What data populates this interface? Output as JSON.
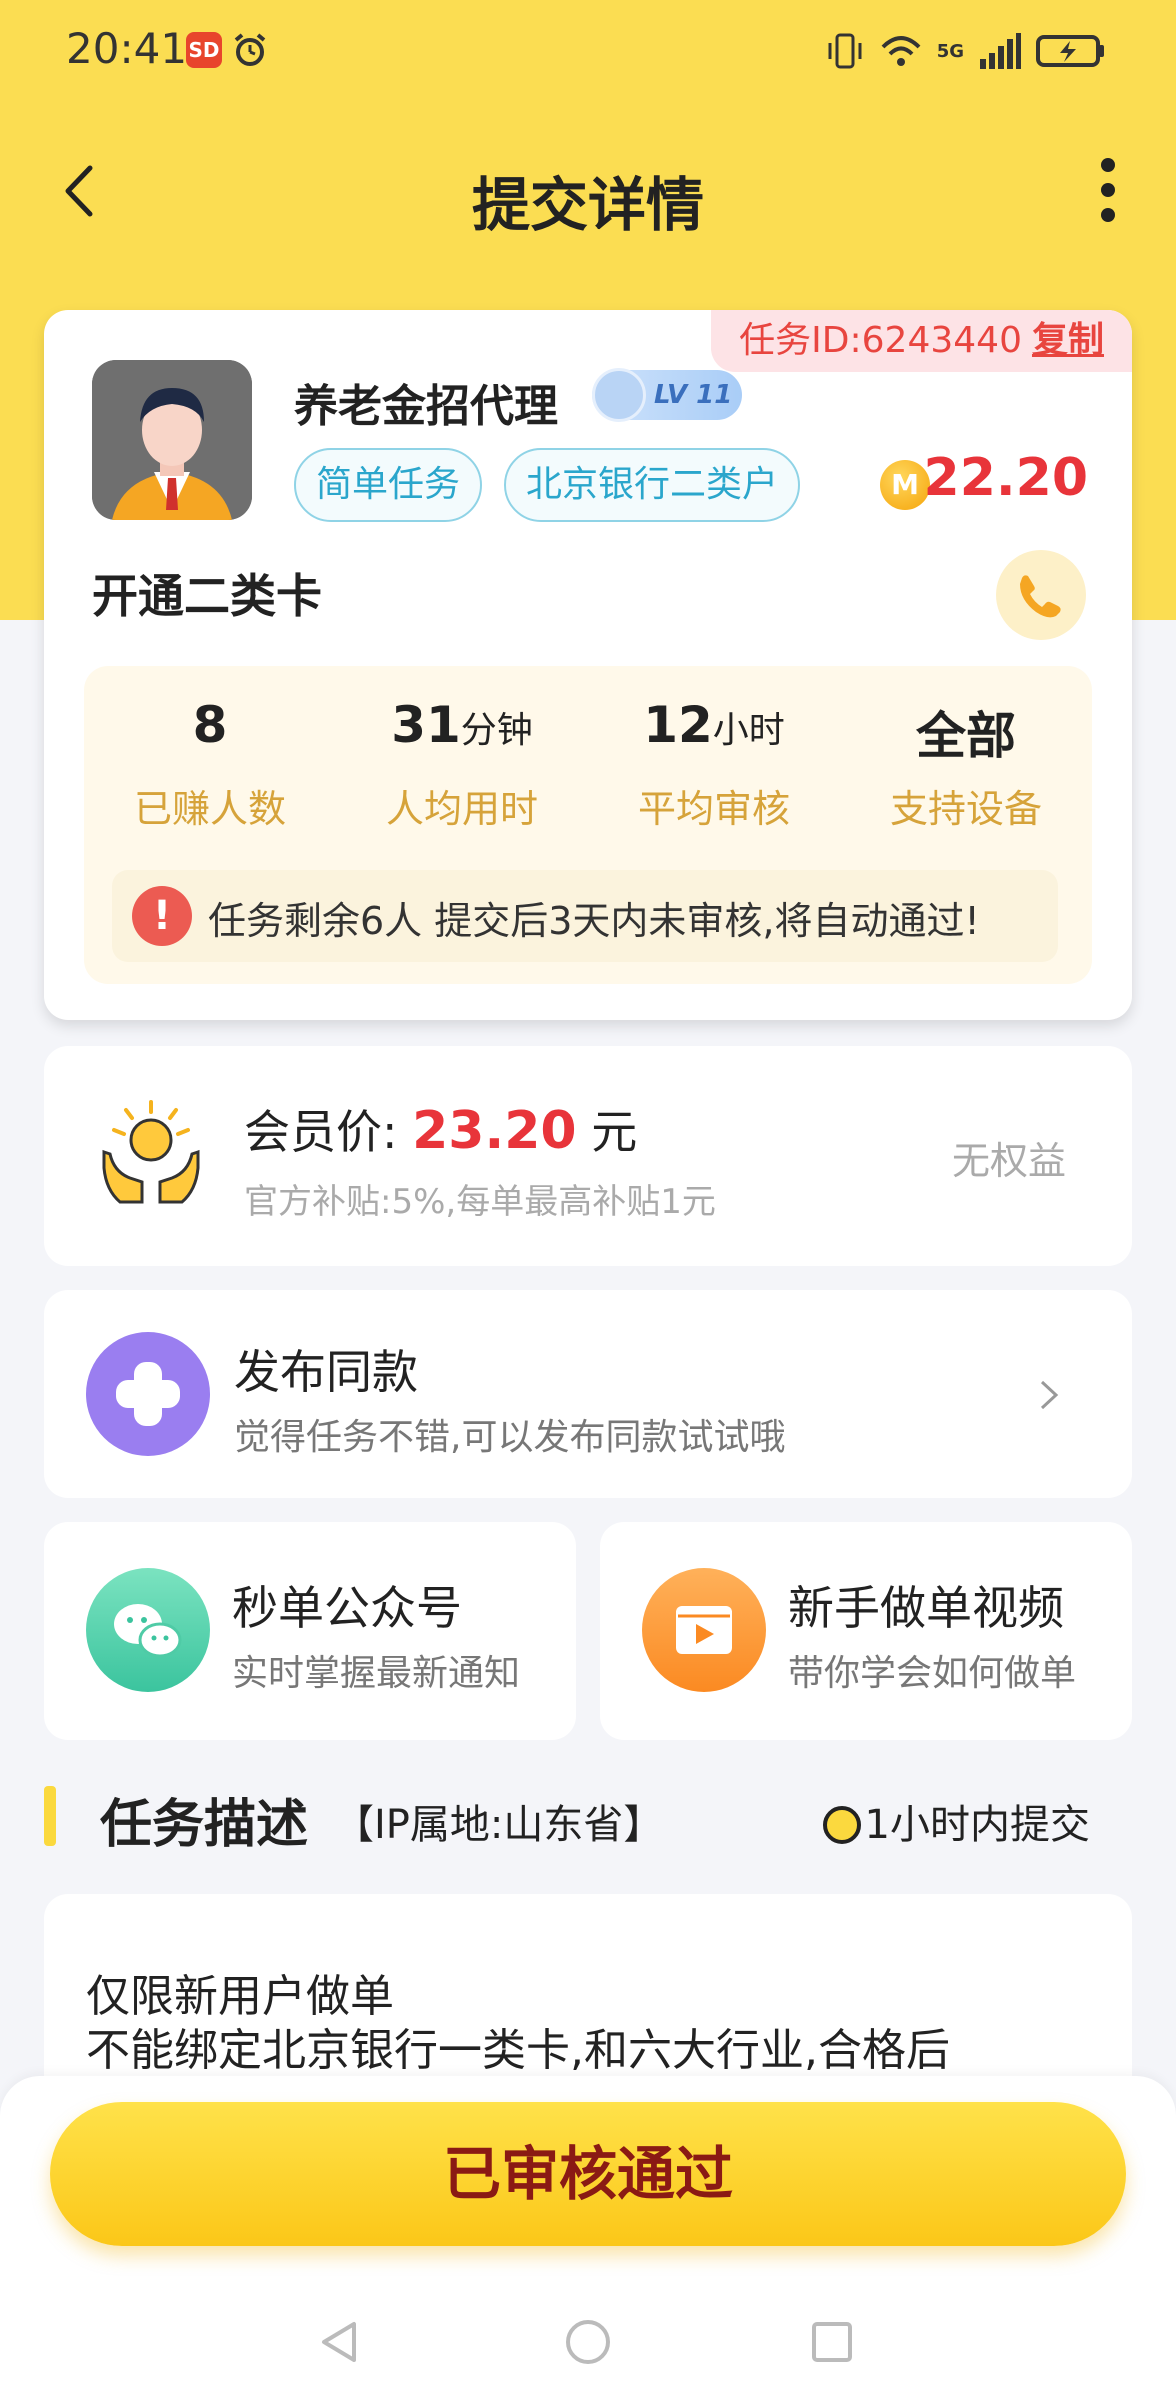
{
  "status_bar": {
    "time": "20:41",
    "app_icon_text": "SD",
    "network_label": "5G"
  },
  "nav": {
    "title": "提交详情"
  },
  "task": {
    "id_label": "任务ID:6243440",
    "copy_label": "复制",
    "publisher_name": "养老金招代理",
    "level_label": "LV 11",
    "tags": [
      "简单任务",
      "北京银行二类户"
    ],
    "coin_symbol": "M",
    "reward": "22.20",
    "title": "开通二类卡",
    "stats": [
      {
        "value": "8",
        "unit": "",
        "label": "已赚人数"
      },
      {
        "value": "31",
        "unit": "分钟",
        "label": "人均用时"
      },
      {
        "value": "12",
        "unit": "小时",
        "label": "平均审核"
      },
      {
        "value": "全部",
        "unit": "",
        "label": "支持设备"
      }
    ],
    "notice_icon": "!",
    "notice": "任务剩余6人  提交后3天内未审核,将自动通过!"
  },
  "vip": {
    "label": "会员价:",
    "price": "23.20",
    "unit": "元",
    "sub": "官方补贴:5%,每单最高补贴1元",
    "right": "无权益"
  },
  "publish": {
    "title": "发布同款",
    "sub": "觉得任务不错,可以发布同款试试哦"
  },
  "wechat": {
    "title": "秒单公众号",
    "sub": "实时掌握最新通知"
  },
  "video": {
    "title": "新手做单视频",
    "sub": "带你学会如何做单"
  },
  "description": {
    "title": "任务描述",
    "ip": "【IP属地:山东省】",
    "time_limit": "1小时内提交",
    "lines": [
      "仅限新用户做单",
      "不能绑定北京银行一类卡,和六大行业,合格后"
    ]
  },
  "bottom": {
    "button_label": "已审核通过"
  },
  "colors": {
    "brand_yellow": "#fbdd52",
    "price_red": "#e8343a",
    "tag_blue": "#2aa6cc",
    "stat_gold": "#d6a33a"
  }
}
